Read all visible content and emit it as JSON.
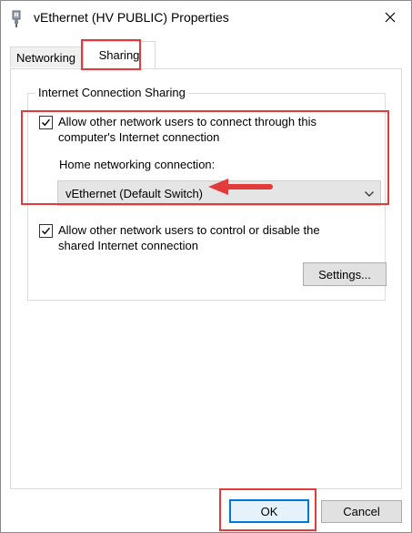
{
  "window": {
    "title": "vEthernet (HV PUBLIC) Properties",
    "title_icon": "network-adapter-icon",
    "close_icon": "close-icon"
  },
  "tabs": [
    {
      "label": "Networking",
      "selected": false
    },
    {
      "label": "Sharing",
      "selected": true
    }
  ],
  "sharing": {
    "group_title": "Internet Connection Sharing",
    "allow_connect": {
      "checked": true,
      "label_line1": "Allow other network users to connect through this",
      "label_line2": "computer's Internet connection"
    },
    "home_networking_label": "Home networking connection:",
    "home_networking_value": "vEthernet (Default Switch)",
    "allow_control": {
      "checked": true,
      "label_line1": "Allow other network users to control or disable the",
      "label_line2": "shared Internet connection"
    },
    "settings_label": "Settings..."
  },
  "footer": {
    "ok_label": "OK",
    "cancel_label": "Cancel"
  },
  "colors": {
    "annotation_red": "#e23b3b",
    "focus_blue": "#0078d7"
  }
}
